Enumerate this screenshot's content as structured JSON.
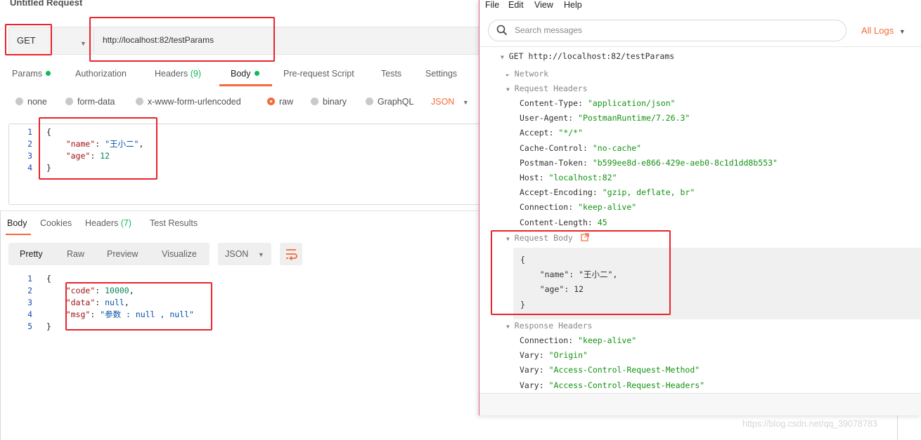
{
  "request": {
    "title": "Untitled Request",
    "method": "GET",
    "url": "http://localhost:82/testParams"
  },
  "request_tabs": [
    {
      "label": "Params",
      "dot": true
    },
    {
      "label": "Authorization"
    },
    {
      "label": "Headers",
      "count": "(9)"
    },
    {
      "label": "Body",
      "dot": true,
      "active": true
    },
    {
      "label": "Pre-request Script"
    },
    {
      "label": "Tests"
    },
    {
      "label": "Settings"
    }
  ],
  "body_types": [
    "none",
    "form-data",
    "x-www-form-urlencoded",
    "raw",
    "binary",
    "GraphQL"
  ],
  "body_type_selected": "raw",
  "body_format": "JSON",
  "request_body": {
    "line_numbers": [
      "1",
      "2",
      "3",
      "4"
    ],
    "open": "{",
    "name_key": "\"name\"",
    "name_value": "\"王小二\"",
    "age_key": "\"age\"",
    "age_value": "12",
    "close": "}"
  },
  "response_tabs": [
    {
      "label": "Body",
      "active": true
    },
    {
      "label": "Cookies"
    },
    {
      "label": "Headers",
      "count": "(7)"
    },
    {
      "label": "Test Results"
    }
  ],
  "view_modes": [
    "Pretty",
    "Raw",
    "Preview",
    "Visualize"
  ],
  "view_format": "JSON",
  "response_body": {
    "line_numbers": [
      "1",
      "2",
      "3",
      "4",
      "5"
    ],
    "open": "{",
    "code_key": "\"code\"",
    "code_value": "10000",
    "data_key": "\"data\"",
    "data_value": "null",
    "msg_key": "\"msg\"",
    "msg_value": "\"参数 : null , null\"",
    "close": "}"
  },
  "console": {
    "menu": [
      "File",
      "Edit",
      "View",
      "Help"
    ],
    "search_placeholder": "Search messages",
    "log_filter": "All Logs",
    "request_line": "GET http://localhost:82/testParams",
    "network_label": "Network",
    "request_headers_label": "Request Headers",
    "request_headers": [
      {
        "key": "Content-Type:",
        "value": "\"application/json\""
      },
      {
        "key": "User-Agent:",
        "value": "\"PostmanRuntime/7.26.3\""
      },
      {
        "key": "Accept:",
        "value": "\"*/*\""
      },
      {
        "key": "Cache-Control:",
        "value": "\"no-cache\""
      },
      {
        "key": "Postman-Token:",
        "value": "\"b599ee8d-e866-429e-aeb0-8c1d1dd8b553\""
      },
      {
        "key": "Host:",
        "value": "\"localhost:82\""
      },
      {
        "key": "Accept-Encoding:",
        "value": "\"gzip, deflate, br\""
      },
      {
        "key": "Connection:",
        "value": "\"keep-alive\""
      },
      {
        "key": "Content-Length:",
        "value": "45"
      }
    ],
    "request_body_label": "Request Body",
    "request_body_lines": {
      "open": "{",
      "name_key": "\"name\"",
      "name_value": "\"王小二\"",
      "age_key": "\"age\"",
      "age_value": "12",
      "close": "}"
    },
    "response_headers_label": "Response Headers",
    "response_headers": [
      {
        "key": "Connection:",
        "value": "\"keep-alive\""
      },
      {
        "key": "Vary:",
        "value": "\"Origin\""
      },
      {
        "key": "Vary:",
        "value": "\"Access-Control-Request-Method\""
      },
      {
        "key": "Vary:",
        "value": "\"Access-Control-Request-Headers\""
      }
    ]
  },
  "watermark": "https://blog.csdn.net/qq_39078783",
  "colors": {
    "accent": "#f26b3a",
    "success_green": "#0cbb52",
    "highlight_red": "#e8242c",
    "console_border": "#e45b93"
  }
}
